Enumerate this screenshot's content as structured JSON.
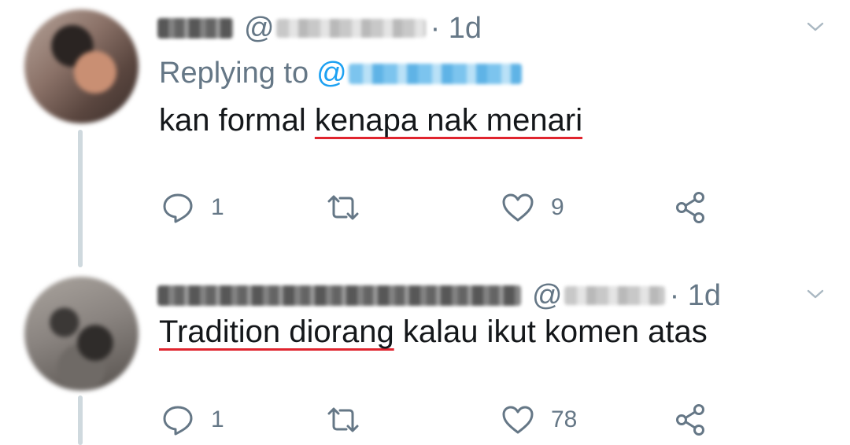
{
  "tweets": [
    {
      "display_name": "",
      "handle_prefix": "@",
      "time": "· 1d",
      "replying_label": "Replying to",
      "replying_mention_prefix": "@",
      "text_plain": "kan formal ",
      "text_underlined": "kenapa nak menari",
      "text_after": "",
      "actions": {
        "reply_count": "1",
        "retweet_count": "",
        "like_count": "9"
      }
    },
    {
      "display_name": "",
      "handle_prefix": "@",
      "time": "· 1d",
      "text_underlined": "Tradition diorang",
      "text_after": " kalau ikut komen atas",
      "actions": {
        "reply_count": "1",
        "retweet_count": "",
        "like_count": "78"
      }
    }
  ],
  "icons": {
    "reply": "reply-icon",
    "retweet": "retweet-icon",
    "like": "heart-icon",
    "share": "share-icon",
    "caret": "chevron-down-icon"
  },
  "colors": {
    "secondary_text": "#657786",
    "primary_text": "#14171a",
    "link": "#1da1f2",
    "underline": "#e0242e",
    "thread_line": "#cfd9de"
  }
}
